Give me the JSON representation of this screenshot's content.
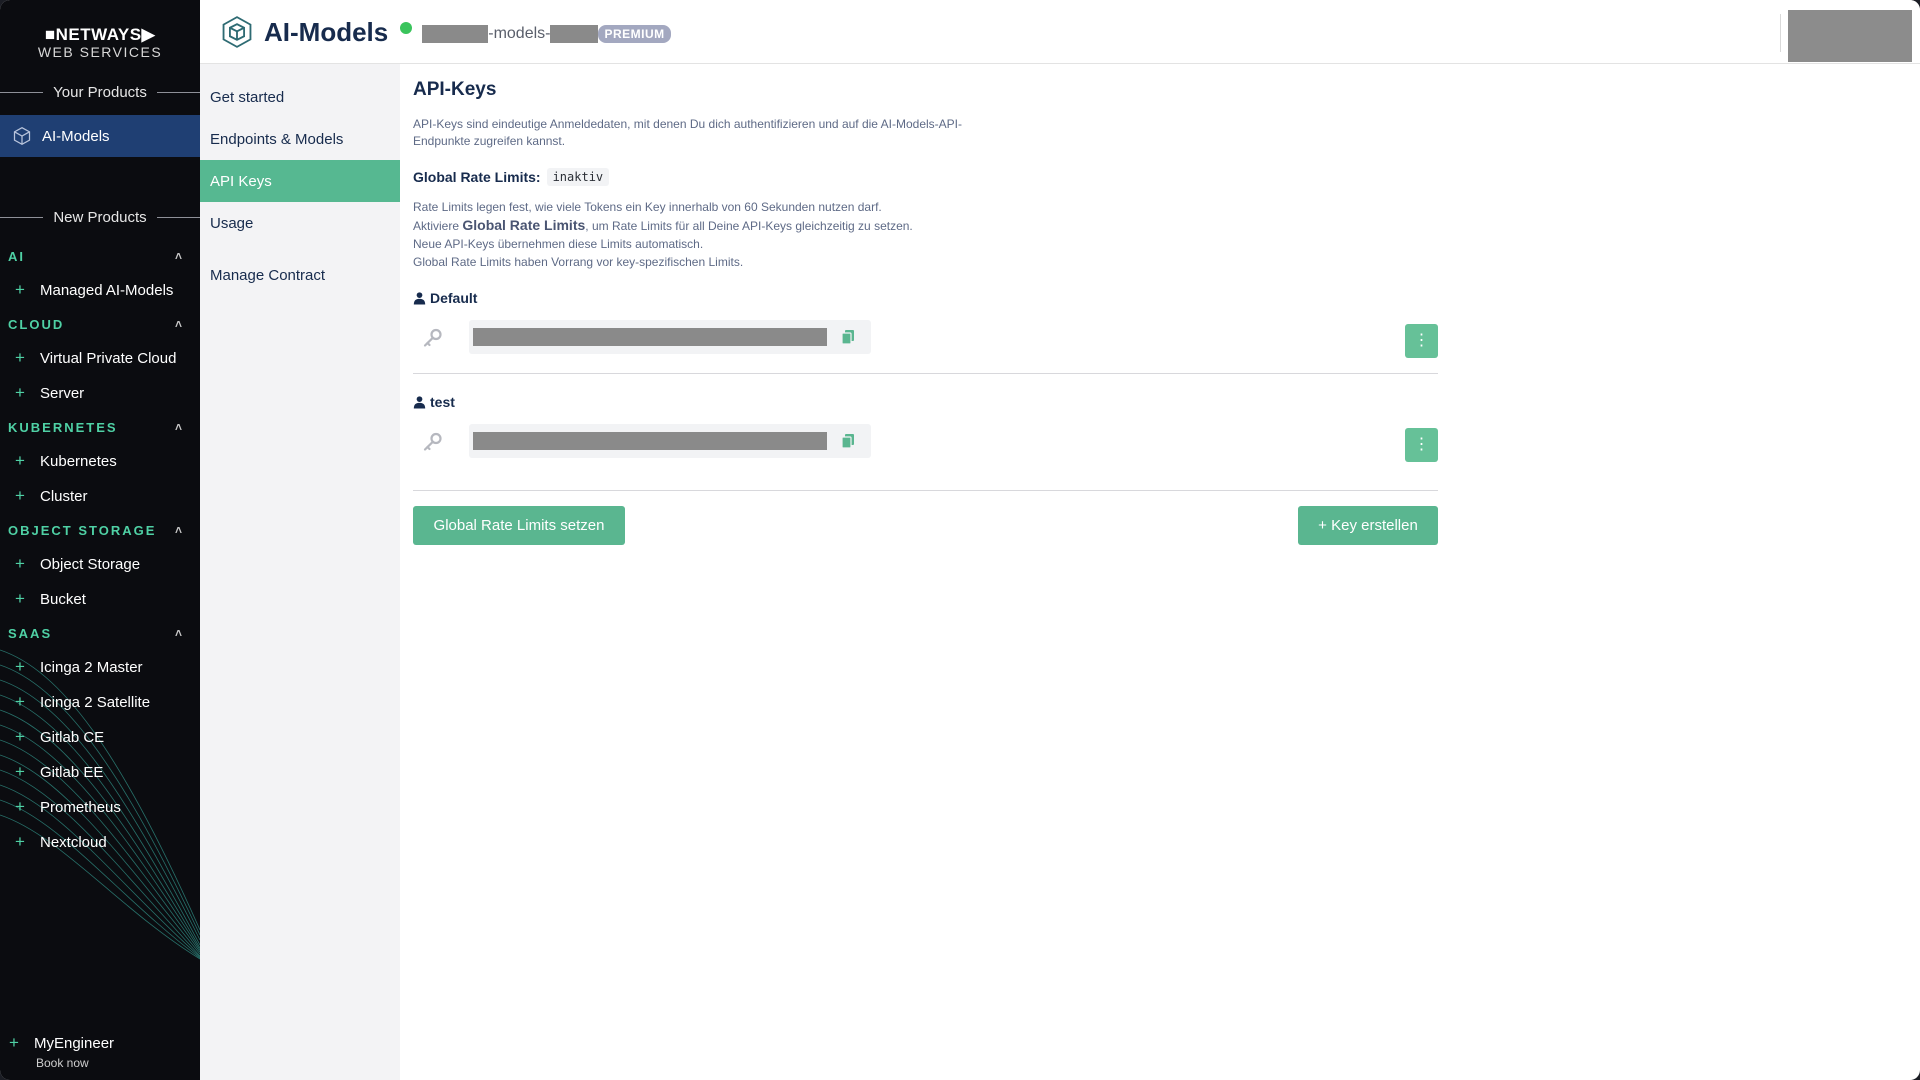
{
  "sidebar": {
    "logo": {
      "brand": "■NETWAYS▶",
      "sub": "WEB SERVICES"
    },
    "your_products_label": "Your Products",
    "active_product": "AI-Models",
    "new_products_label": "New Products",
    "categories": [
      {
        "name": "AI",
        "items": [
          "Managed AI-Models"
        ]
      },
      {
        "name": "CLOUD",
        "items": [
          "Virtual Private Cloud",
          "Server"
        ]
      },
      {
        "name": "KUBERNETES",
        "items": [
          "Kubernetes",
          "Cluster"
        ]
      },
      {
        "name": "OBJECT STORAGE",
        "items": [
          "Object Storage",
          "Bucket"
        ]
      },
      {
        "name": "SAAS",
        "items": [
          "Icinga 2 Master",
          "Icinga 2 Satellite",
          "Gitlab CE",
          "Gitlab EE",
          "Prometheus",
          "Nextcloud"
        ]
      }
    ],
    "engineer": {
      "label": "MyEngineer",
      "sub": "Book now"
    }
  },
  "header": {
    "title": "AI-Models",
    "project_middle": "-models-",
    "badge": "PREMIUM",
    "status_color": "#3ac45c"
  },
  "subnav": {
    "items": [
      "Get started",
      "Endpoints & Models",
      "API Keys",
      "Usage",
      "Manage Contract"
    ],
    "active": "API Keys"
  },
  "main": {
    "title": "API-Keys",
    "description": "API-Keys sind eindeutige Anmeldedaten, mit denen Du dich authentifizieren und auf die AI-Models-API-Endpunkte zugreifen kannst.",
    "global_rate_label": "Global Rate Limits:",
    "global_rate_status": "inaktiv",
    "rate_line1": "Rate Limits legen fest, wie viele Tokens ein Key innerhalb von 60 Sekunden nutzen darf.",
    "rate_line2_pre": "Aktiviere ",
    "rate_line2_bold": "Global Rate Limits",
    "rate_line2_post": ", um Rate Limits für all Deine API-Keys gleichzeitig zu setzen.",
    "rate_line3": "Neue API-Keys übernehmen diese Limits automatisch.",
    "rate_line4": "Global Rate Limits haben Vorrang vor key-spezifischen Limits.",
    "keys": [
      {
        "name": "Default"
      },
      {
        "name": "test"
      }
    ],
    "set_rate_button": "Global Rate Limits setzen",
    "create_key_button": "+ Key erstellen",
    "accent": "#5ab690"
  }
}
